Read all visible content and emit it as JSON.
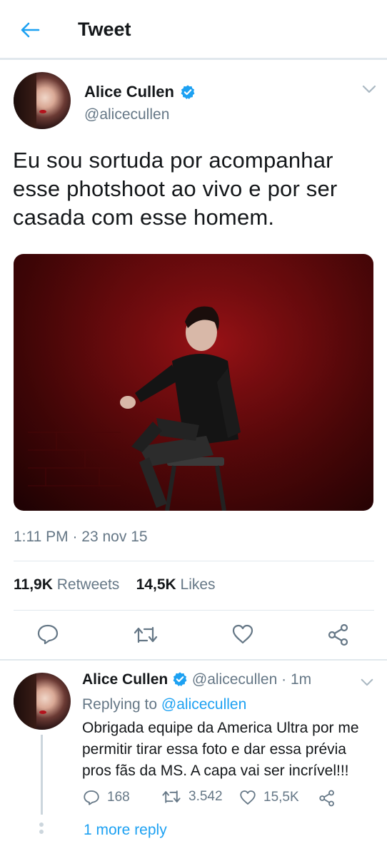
{
  "header": {
    "title": "Tweet"
  },
  "tweet": {
    "author_name": "Alice Cullen",
    "author_handle": "@alicecullen",
    "text": "Eu sou sortuda por acompanhar esse photshoot ao vivo e por ser casada com esse homem.",
    "timestamp": "1:11 PM · 23 nov 15",
    "retweets_count": "11,9K",
    "retweets_label": "Retweets",
    "likes_count": "14,5K",
    "likes_label": "Likes"
  },
  "reply": {
    "author_name": "Alice Cullen",
    "author_handle": "@alicecullen",
    "time": "· 1m",
    "replying_prefix": "Replying to",
    "replying_to": "@alicecullen",
    "text": "Obrigada equipe da America Ultra por me permitir tirar essa foto e dar essa prévia pros fãs da MS. A capa vai ser incrível!!!",
    "replies": "168",
    "retweets": "3.542",
    "likes": "15,5K",
    "more_reply_label": "1 more reply"
  },
  "colors": {
    "accent": "#1da1f2",
    "secondary_text": "#657786",
    "divider": "#e1e8ed"
  },
  "icons": [
    "back-arrow-icon",
    "verified-badge-icon",
    "chevron-down-icon",
    "reply-icon",
    "retweet-icon",
    "like-icon",
    "share-icon"
  ]
}
